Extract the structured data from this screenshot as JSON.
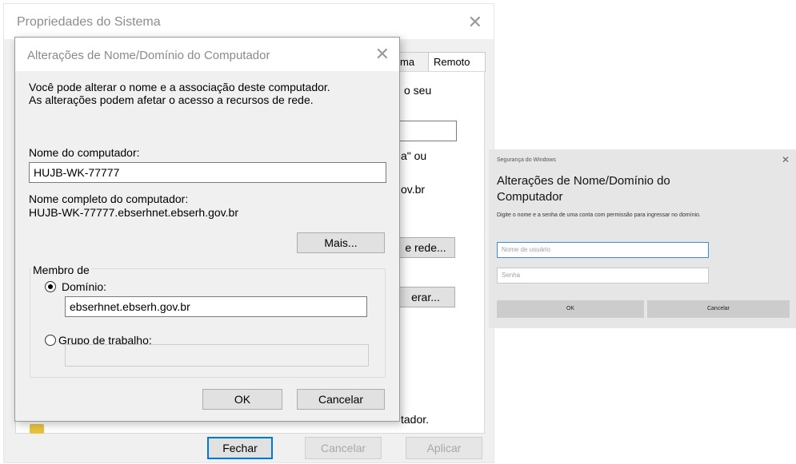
{
  "system_properties": {
    "title": "Propriedades do Sistema",
    "tabs_visible": [
      "ma",
      "Remoto"
    ],
    "text_fragments": [
      "o seu",
      "a\" ou",
      "ov.br",
      "tador."
    ],
    "buttons": {
      "network": "e rede...",
      "change": "erar...",
      "close": "Fechar",
      "cancel": "Cancelar",
      "apply": "Aplicar"
    }
  },
  "name_dialog": {
    "title": "Alterações de Nome/Domínio do Computador",
    "intro_line1": "Você pode alterar o nome e a associação deste computador.",
    "intro_line2": "As alterações podem afetar o acesso a recursos de rede.",
    "computer_name_label": "Nome do computador:",
    "computer_name_value": "HUJB-WK-77777",
    "full_name_label": "Nome completo do computador:",
    "full_name_value": "HUJB-WK-77777.ebserhnet.ebserh.gov.br",
    "more_button": "Mais...",
    "member_of_label": "Membro de",
    "domain_label": "Domínio:",
    "domain_value": "ebserhnet.ebserh.gov.br",
    "domain_selected": true,
    "workgroup_label": "Grupo de trabalho:",
    "workgroup_value": "",
    "ok_button": "OK",
    "cancel_button": "Cancelar"
  },
  "windows_security": {
    "header": "Segurança do Windows",
    "heading": "Alterações de Nome/Domínio do Computador",
    "description": "Digite o nome e a senha de uma conta com permissão para ingressar no domínio.",
    "username_placeholder": "Nome de usuário",
    "password_placeholder": "Senha",
    "ok_button": "OK",
    "cancel_button": "Cancelar"
  },
  "icons": {
    "close": "close-icon",
    "radio": "radio-button"
  },
  "colors": {
    "focus_accent": "#0078d7",
    "dialog_bg": "#f0f0f0",
    "security_bg": "#e6e6e6"
  }
}
